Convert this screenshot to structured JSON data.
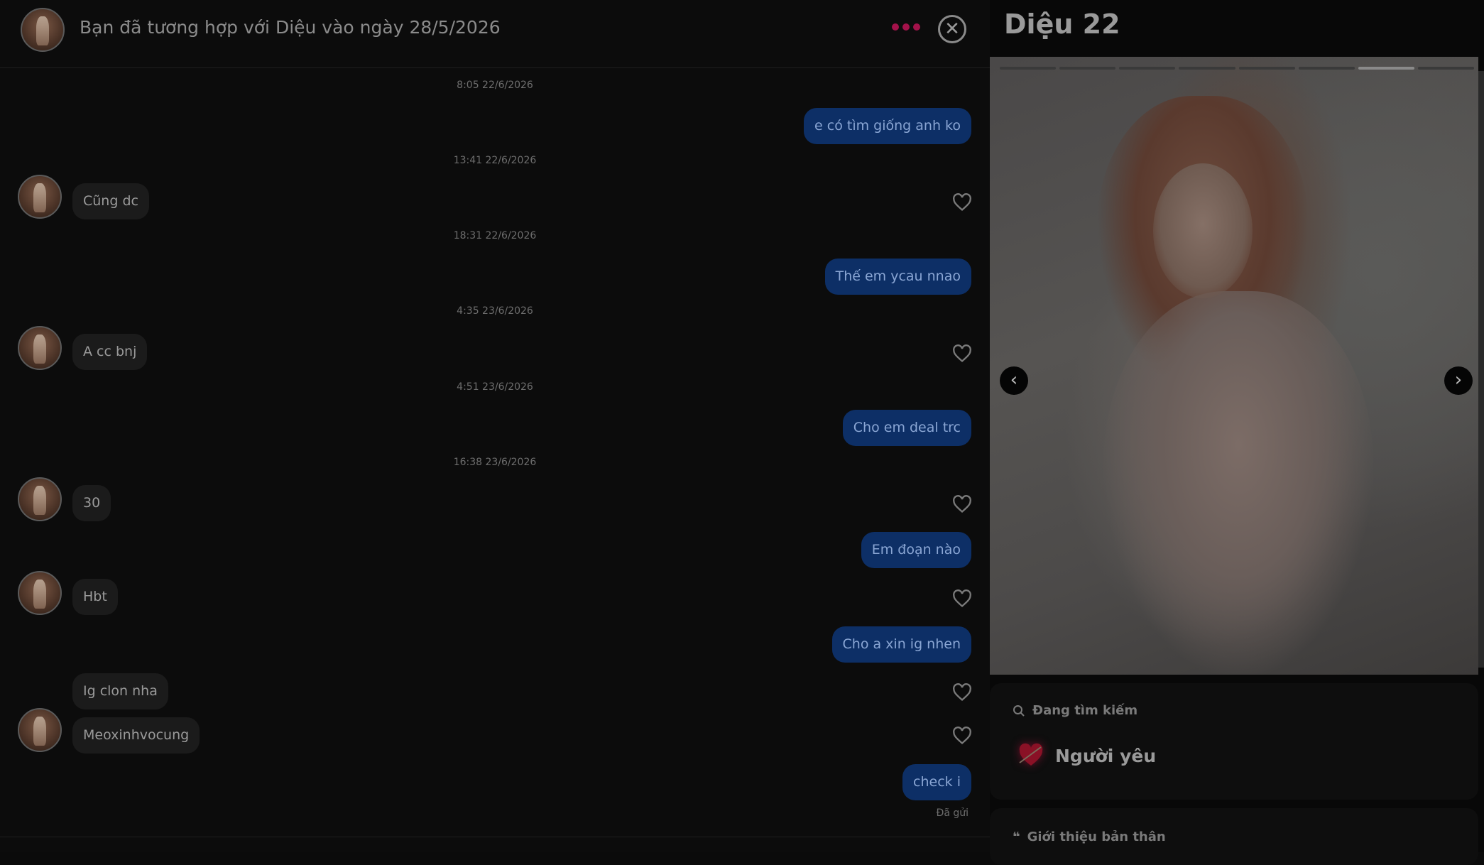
{
  "header": {
    "title": "Bạn đã tương hợp với Diệu vào ngày 28/5/2026"
  },
  "messages": [
    {
      "timestamp": "8:05 22/6/2026",
      "text": "e có tìm giống anh ko",
      "dir": "out"
    },
    {
      "timestamp": "13:41 22/6/2026",
      "text": "Cũng dc",
      "dir": "in"
    },
    {
      "timestamp": "18:31 22/6/2026",
      "text": "Thế em ycau nnao",
      "dir": "out"
    },
    {
      "timestamp": "4:35 23/6/2026",
      "text": "A cc bnj",
      "dir": "in"
    },
    {
      "timestamp": "4:51 23/6/2026",
      "text": "Cho em deal trc",
      "dir": "out"
    },
    {
      "timestamp": "16:38 23/6/2026",
      "text": "30",
      "dir": "in"
    },
    {
      "text": "Em đoạn nào",
      "dir": "out"
    },
    {
      "text": "Hbt",
      "dir": "in"
    },
    {
      "text": "Cho a xin ig nhen",
      "dir": "out"
    },
    {
      "text": "Ig clon nha",
      "dir": "in"
    },
    {
      "text": "Meoxinhvocung",
      "dir": "in"
    },
    {
      "text": "check i",
      "dir": "out"
    }
  ],
  "sent_status": "Đã gửi",
  "profile": {
    "name": "Diệu 22",
    "photo_count": 8,
    "active_photo_index": 6,
    "looking_for": {
      "label": "Đang tìm kiếm",
      "value": "Người yêu"
    },
    "bio": {
      "label": "Giới thiệu bản thân"
    }
  },
  "colors": {
    "outgoing_bubble": "#0d2f66",
    "incoming_bubble": "#1b1b1b",
    "accent_dots": "#a3124a"
  },
  "icons": {
    "close": "close-icon",
    "more": "more-dots-icon",
    "like": "heart-outline-icon",
    "prev": "chevron-left-icon",
    "next": "chevron-right-icon",
    "search": "search-icon",
    "quote": "quote-icon",
    "heart_emoji": "heart-arrow-emoji"
  }
}
